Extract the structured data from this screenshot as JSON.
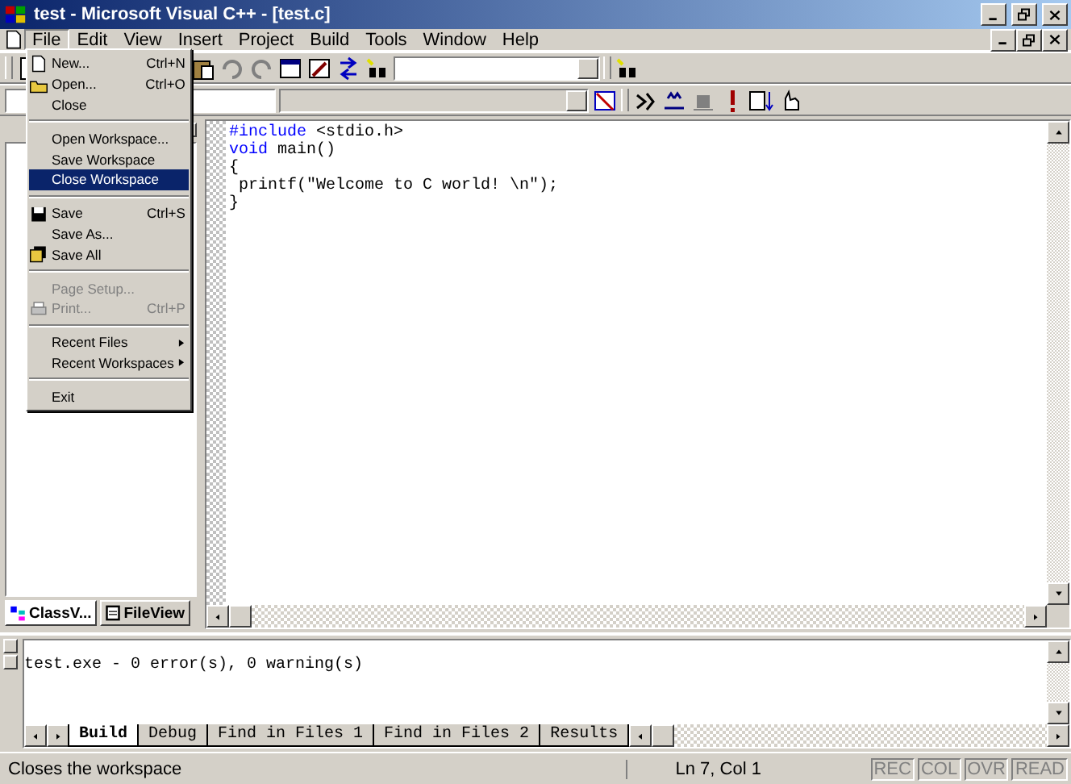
{
  "window": {
    "title": "test - Microsoft Visual C++ - [test.c]"
  },
  "menu_bar": [
    {
      "label": "File",
      "selected": true
    },
    {
      "label": "Edit",
      "selected": false
    },
    {
      "label": "View",
      "selected": false
    },
    {
      "label": "Insert",
      "selected": false
    },
    {
      "label": "Project",
      "selected": false
    },
    {
      "label": "Build",
      "selected": false
    },
    {
      "label": "Tools",
      "selected": false
    },
    {
      "label": "Window",
      "selected": false
    },
    {
      "label": "Help",
      "selected": false
    }
  ],
  "file_menu": [
    {
      "kind": "item",
      "label": "New...",
      "shortcut": "Ctrl+N",
      "disabled": false,
      "selected": false
    },
    {
      "kind": "item",
      "label": "Open...",
      "shortcut": "Ctrl+O",
      "disabled": false,
      "selected": false
    },
    {
      "kind": "item",
      "label": "Close",
      "disabled": false,
      "selected": false
    },
    {
      "kind": "separator"
    },
    {
      "kind": "item",
      "label": "Open Workspace...",
      "disabled": false,
      "selected": false
    },
    {
      "kind": "item",
      "label": "Save Workspace",
      "disabled": false,
      "selected": false
    },
    {
      "kind": "item",
      "label": "Close Workspace",
      "disabled": false,
      "selected": true
    },
    {
      "kind": "separator"
    },
    {
      "kind": "item",
      "label": "Save",
      "shortcut": "Ctrl+S",
      "disabled": false,
      "selected": false
    },
    {
      "kind": "item",
      "label": "Save As...",
      "disabled": false,
      "selected": false
    },
    {
      "kind": "item",
      "label": "Save All",
      "disabled": false,
      "selected": false
    },
    {
      "kind": "separator"
    },
    {
      "kind": "item",
      "label": "Page Setup...",
      "disabled": true,
      "selected": false
    },
    {
      "kind": "item",
      "label": "Print...",
      "shortcut": "Ctrl+P",
      "disabled": true,
      "selected": false
    },
    {
      "kind": "separator"
    },
    {
      "kind": "submenu",
      "label": "Recent Files",
      "disabled": false,
      "selected": false
    },
    {
      "kind": "submenu",
      "label": "Recent Workspaces",
      "disabled": false,
      "selected": false
    },
    {
      "kind": "separator"
    },
    {
      "kind": "item",
      "label": "Exit",
      "disabled": false,
      "selected": false
    }
  ],
  "workspace_tabs": [
    {
      "label": "ClassV...",
      "selected": true
    },
    {
      "label": "FileView",
      "selected": false
    }
  ],
  "editor": {
    "lines": [
      [
        {
          "text": "#include",
          "keyword": true
        },
        {
          "text": " <stdio.h>",
          "keyword": false
        }
      ],
      [
        {
          "text": "void",
          "keyword": true
        },
        {
          "text": " main()",
          "keyword": false
        }
      ],
      [
        {
          "text": "{",
          "keyword": false
        }
      ],
      [
        {
          "text": " printf(\"Welcome to C world! \\n\");",
          "keyword": false
        }
      ],
      [
        {
          "text": "}",
          "keyword": false
        }
      ]
    ]
  },
  "output": {
    "text": "test.exe - 0 error(s), 0 warning(s)",
    "tabs": [
      {
        "label": "Build",
        "selected": true
      },
      {
        "label": "Debug",
        "selected": false
      },
      {
        "label": "Find in Files 1",
        "selected": false
      },
      {
        "label": "Find in Files 2",
        "selected": false
      },
      {
        "label": "Results",
        "selected": false
      }
    ]
  },
  "status_bar": {
    "message": "Closes the workspace",
    "position": "Ln 7, Col 1",
    "indicators": [
      {
        "label": "REC",
        "disabled": true
      },
      {
        "label": "COL",
        "disabled": true
      },
      {
        "label": "OVR",
        "disabled": true
      },
      {
        "label": "READ",
        "disabled": true
      }
    ]
  }
}
